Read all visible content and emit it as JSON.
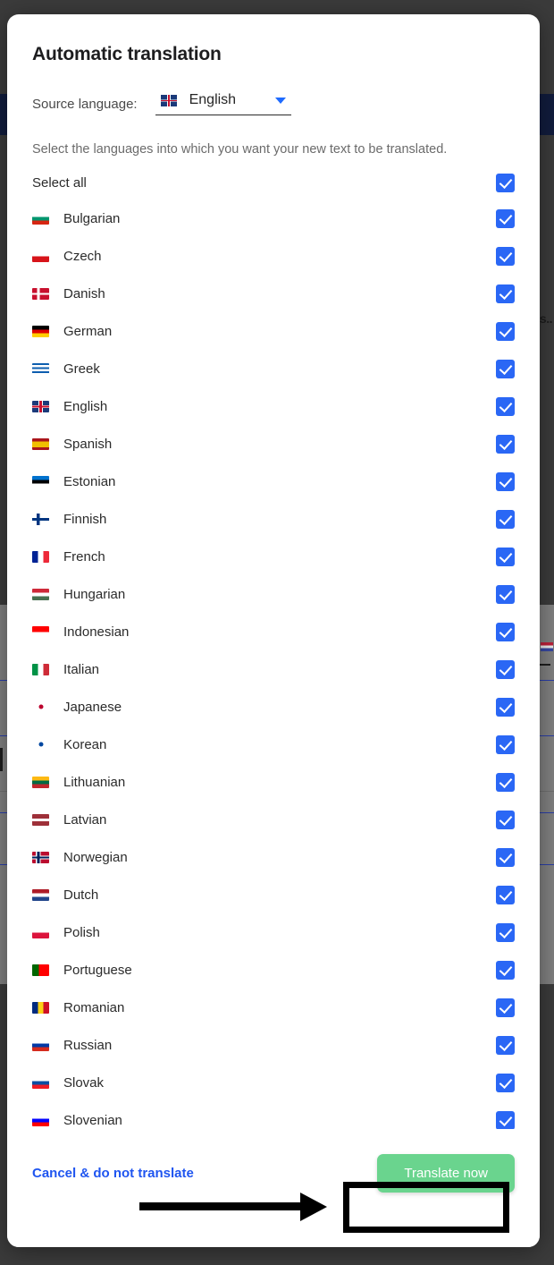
{
  "modal": {
    "title": "Automatic translation",
    "source_language_label": "Source language:",
    "source_language_value": "English",
    "source_language_flag": "flag-gb-icon",
    "caret_icon": "chevron-down-icon",
    "hint": "Select the languages into which you want your new text to be translated.",
    "select_all_label": "Select all",
    "select_all_checked": true
  },
  "languages": [
    {
      "name": "Bulgarian",
      "flag": "flag-bg-icon",
      "checked": true
    },
    {
      "name": "Czech",
      "flag": "flag-cz-icon",
      "checked": true
    },
    {
      "name": "Danish",
      "flag": "flag-dk-icon",
      "checked": true
    },
    {
      "name": "German",
      "flag": "flag-de-icon",
      "checked": true
    },
    {
      "name": "Greek",
      "flag": "flag-gr-icon",
      "checked": true
    },
    {
      "name": "English",
      "flag": "flag-gb-icon",
      "checked": true
    },
    {
      "name": "Spanish",
      "flag": "flag-es-icon",
      "checked": true
    },
    {
      "name": "Estonian",
      "flag": "flag-ee-icon",
      "checked": true
    },
    {
      "name": "Finnish",
      "flag": "flag-fi-icon",
      "checked": true
    },
    {
      "name": "French",
      "flag": "flag-fr-icon",
      "checked": true
    },
    {
      "name": "Hungarian",
      "flag": "flag-hu-icon",
      "checked": true
    },
    {
      "name": "Indonesian",
      "flag": "flag-id-icon",
      "checked": true
    },
    {
      "name": "Italian",
      "flag": "flag-it-icon",
      "checked": true
    },
    {
      "name": "Japanese",
      "flag": "flag-jp-icon",
      "checked": true
    },
    {
      "name": "Korean",
      "flag": "flag-kr-icon",
      "checked": true
    },
    {
      "name": "Lithuanian",
      "flag": "flag-lt-icon",
      "checked": true
    },
    {
      "name": "Latvian",
      "flag": "flag-lv-icon",
      "checked": true
    },
    {
      "name": "Norwegian",
      "flag": "flag-no-icon",
      "checked": true
    },
    {
      "name": "Dutch",
      "flag": "flag-nl-icon",
      "checked": true
    },
    {
      "name": "Polish",
      "flag": "flag-pl-icon",
      "checked": true
    },
    {
      "name": "Portuguese",
      "flag": "flag-pt-icon",
      "checked": true
    },
    {
      "name": "Romanian",
      "flag": "flag-ro-icon",
      "checked": true
    },
    {
      "name": "Russian",
      "flag": "flag-ru-icon",
      "checked": true
    },
    {
      "name": "Slovak",
      "flag": "flag-sk-icon",
      "checked": true
    },
    {
      "name": "Slovenian",
      "flag": "flag-si-icon",
      "checked": true
    }
  ],
  "footer": {
    "cancel_label": "Cancel & do not translate",
    "translate_label": "Translate now"
  },
  "background": {
    "snippet": "s.."
  },
  "colors": {
    "checkbox": "#2a67f5",
    "primary_button": "#6ad48e",
    "link": "#1f55f0",
    "caret": "#1f6bff",
    "annotation": "#000000",
    "backdrop": "#3b3b3b",
    "navy_band": "#111c3d"
  }
}
